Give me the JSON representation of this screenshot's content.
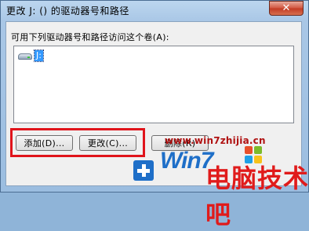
{
  "window": {
    "title": "更改 J: () 的驱动器号和路径",
    "close_glyph": "✕"
  },
  "list": {
    "label": "可用下列驱动器号和路径访问这个卷(A):",
    "items": [
      {
        "label": "J:",
        "icon": "drive-icon"
      }
    ]
  },
  "buttons": {
    "add": "添加(D)...",
    "change": "更改(C)...",
    "remove": "删除(R)"
  },
  "watermark": {
    "url": "www.win7zhijia.cn",
    "win_text": "Win7",
    "logo_text": "电脑技术吧"
  }
}
